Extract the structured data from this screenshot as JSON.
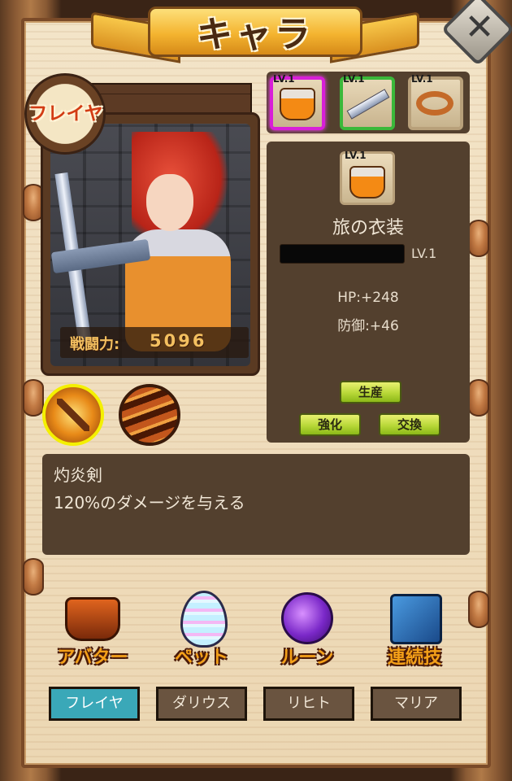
{
  "header": {
    "title": "キャラ",
    "close_icon": "close-x-icon"
  },
  "character": {
    "name": "フレイヤ",
    "power_label": "戦闘力:",
    "power_value": "5096"
  },
  "skills": [
    {
      "icon": "flame-sword-icon",
      "selected": true
    },
    {
      "icon": "fire-orb-icon",
      "selected": false
    }
  ],
  "equipment": {
    "slots": [
      {
        "level": "LV.1",
        "icon": "dress-icon",
        "rarity_color": "#d81fd8"
      },
      {
        "level": "LV.1",
        "icon": "sword-icon",
        "rarity_color": "#3ab83a"
      },
      {
        "level": "LV.1",
        "icon": "ring-icon",
        "rarity_color": "#b8a07a"
      }
    ],
    "selected": {
      "level_badge": "LV.1",
      "name": "旅の衣装",
      "level": "LV.1",
      "hp": "HP:+248",
      "defense": "防御:+46"
    },
    "buttons": {
      "produce": "生産",
      "enhance": "強化",
      "exchange": "交換"
    }
  },
  "skill_detail": {
    "name": "灼炎剣",
    "description": "120%のダメージを与える"
  },
  "menu": [
    {
      "label": "アバター",
      "icon": "armor-icon"
    },
    {
      "label": "ペット",
      "icon": "egg-icon"
    },
    {
      "label": "ルーン",
      "icon": "rune-icon"
    },
    {
      "label": "連続技",
      "icon": "book-icon"
    }
  ],
  "character_tabs": [
    {
      "label": "フレイヤ",
      "active": true
    },
    {
      "label": "ダリウス",
      "active": false
    },
    {
      "label": "リヒト",
      "active": false
    },
    {
      "label": "マリア",
      "active": false
    }
  ],
  "colors": {
    "panel": "#53402e",
    "accent_gold": "#f4c060",
    "active_tab": "#3aa8b8",
    "button_green": "#b8d838"
  }
}
